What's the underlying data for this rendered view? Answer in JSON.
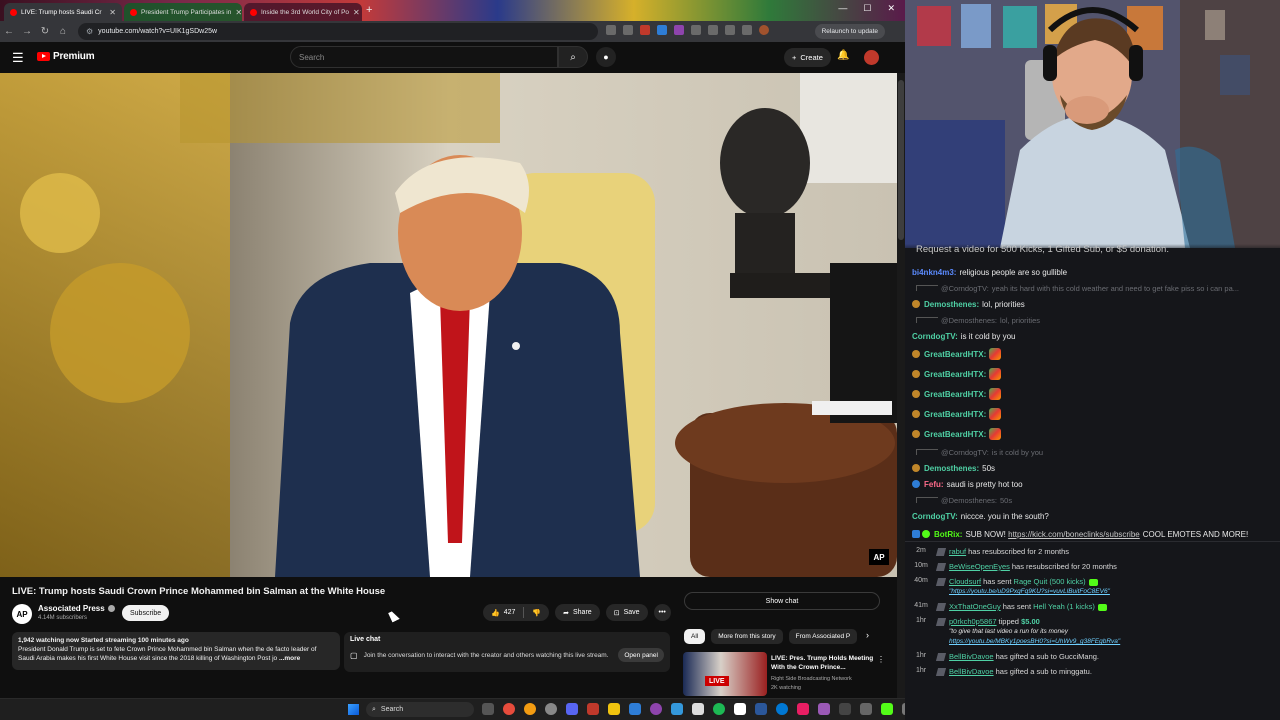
{
  "browser": {
    "tabs": [
      {
        "label": "LIVE: Trump hosts Saudi Cr",
        "active": true
      },
      {
        "label": "President Trump Participates in",
        "active": false
      },
      {
        "label": "Inside the 3rd World City of Po",
        "active": false
      }
    ],
    "url": "youtube.com/watch?v=UIK1gSDw25w",
    "relaunch_label": "Relaunch to update"
  },
  "youtube": {
    "logo_text": "Premium",
    "search_placeholder": "Search",
    "create_label": "Create",
    "video": {
      "title": "LIVE: Trump hosts Saudi Crown Prince Mohammed bin Salman at the White House",
      "watermark": "AP"
    },
    "channel": {
      "avatar_text": "AP",
      "name": "Associated Press",
      "subscribers": "4.14M subscribers",
      "subscribe_label": "Subscribe"
    },
    "actions": {
      "likes": "427",
      "share_label": "Share",
      "save_label": "Save"
    },
    "description": {
      "stats": "1,942 watching now  Started streaming 100 minutes ago",
      "text": "President Donald Trump is set to fete Crown Prince Mohammed bin Salman when the de facto leader of Saudi Arabia makes his first White House visit since the 2018 killing of Washington Post jo",
      "more_label": "...more"
    },
    "live_chat_card": {
      "title": "Live chat",
      "text": "Join the conversation to interact with the creator and others watching this live stream.",
      "open_label": "Open panel"
    },
    "show_chat_label": "Show chat",
    "chips": [
      "All",
      "More from this story",
      "From Associated P"
    ],
    "recommendation": {
      "live_badge": "LIVE",
      "title": "LIVE: Pres. Trump Holds Meeting With the Crown Prince...",
      "channel": "Right Side Broadcasting Network",
      "meta": "2K watching"
    }
  },
  "taskbar": {
    "search_label": "Search"
  },
  "stream": {
    "caption": "Request a video for 500 Kicks, 1 Gifted Sub, or $5 donation.",
    "chat": [
      {
        "type": "msg",
        "user": "bi4nkn4m3:",
        "color": "#5b8bff",
        "text": "religious people are so gullible",
        "badge": ""
      },
      {
        "type": "reply",
        "user": "@CorndogTV:",
        "text": "yeah its hard with this cold weather and need to get fake piss so i can pa..."
      },
      {
        "type": "msg",
        "user": "Demosthenes:",
        "color": "#4fd1a5",
        "text": "lol, priorities",
        "badge": "#c0862a"
      },
      {
        "type": "reply",
        "user": "@Demosthenes:",
        "text": "lol, priorities"
      },
      {
        "type": "msg",
        "user": "CorndogTV:",
        "color": "#4fd1a5",
        "text": "is it cold by you",
        "badge": ""
      },
      {
        "type": "emote",
        "user": "GreatBeardHTX:",
        "color": "#4fd1a5",
        "badge": "#c0862a"
      },
      {
        "type": "emote",
        "user": "GreatBeardHTX:",
        "color": "#4fd1a5",
        "badge": "#c0862a"
      },
      {
        "type": "emote",
        "user": "GreatBeardHTX:",
        "color": "#4fd1a5",
        "badge": "#c0862a"
      },
      {
        "type": "emote",
        "user": "GreatBeardHTX:",
        "color": "#4fd1a5",
        "badge": "#c0862a"
      },
      {
        "type": "emote",
        "user": "GreatBeardHTX:",
        "color": "#4fd1a5",
        "badge": "#c0862a"
      },
      {
        "type": "reply",
        "user": "@CorndogTV:",
        "text": "is it cold by you"
      },
      {
        "type": "msg",
        "user": "Demosthenes:",
        "color": "#4fd1a5",
        "text": "50s",
        "badge": "#c0862a"
      },
      {
        "type": "msg",
        "user": "Fefu:",
        "color": "#ff6b8a",
        "text": "saudi is pretty hot too",
        "badge": "#2e7dd6"
      },
      {
        "type": "reply",
        "user": "@Demosthenes:",
        "text": "50s"
      },
      {
        "type": "msg",
        "user": "CorndogTV:",
        "color": "#4fd1a5",
        "text": "niccce. you in the south?",
        "badge": ""
      },
      {
        "type": "bot",
        "user": "BotRix:",
        "color": "#53fc18",
        "pre": "SUB NOW!",
        "link": "https://kick.com/boneclinks/subscribe",
        "text": "COOL EMOTES AND MORE!"
      }
    ],
    "feed": [
      {
        "time": "2m",
        "user": "rabuf",
        "text": "has resubscribed for 2 months"
      },
      {
        "time": "10m",
        "user": "BeWiseOpenEyes",
        "text": "has resubscribed for 20 months"
      },
      {
        "time": "40m",
        "user": "Cloudsurf",
        "text": "has sent",
        "highlight": "Rage Quit (500 kicks)",
        "sub": "\"https://youtu.be/uD9PxqFq9KU?si=vuvLlBuitFoC8EV6\"",
        "kick": true
      },
      {
        "time": "41m",
        "user": "XxThatOneGuy",
        "text": "has sent",
        "highlight": "Hell Yeah (1 kicks)",
        "kick": true
      },
      {
        "time": "1hr",
        "user": "p0rkch0p5867",
        "text": "tipped",
        "money": "$5.00",
        "quote": "\"to give that last video a run for its money",
        "sub": "https://youtu.be/MBKy1poesBH0?si=UhWv9_g38FEgbRva\"",
        "plain": true
      },
      {
        "time": "1hr",
        "user": "BellBivDavoe",
        "text": "has gifted a sub to",
        "target": "GucciMang."
      },
      {
        "time": "1hr",
        "user": "BellBivDavoe",
        "text": "has gifted a sub to",
        "target": "minggatu."
      }
    ]
  }
}
